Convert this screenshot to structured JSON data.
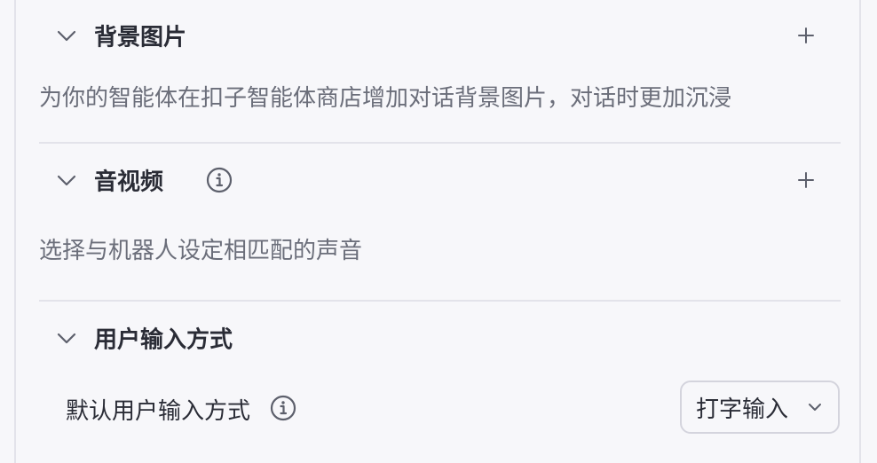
{
  "sections": [
    {
      "title": "背景图片",
      "description": "为你的智能体在扣子智能体商店增加对话背景图片，对话时更加沉浸",
      "add_icon": "plus-icon",
      "collapse_icon": "chevron-down-icon"
    },
    {
      "title": "音视频",
      "description": "选择与机器人设定相匹配的声音",
      "info_icon": "info-icon",
      "add_icon": "plus-icon",
      "collapse_icon": "chevron-down-icon"
    },
    {
      "title": "用户输入方式",
      "collapse_icon": "chevron-down-icon",
      "setting": {
        "label": "默认用户输入方式",
        "info_icon": "info-icon",
        "selected_value": "打字输入",
        "dropdown_icon": "chevron-down-icon"
      }
    }
  ],
  "colors": {
    "background": "#f7f7fa",
    "title_text": "#2a2c36",
    "description_text": "#6b6e7a",
    "divider": "#e3e3ea",
    "icon": "#6b6e7a"
  }
}
